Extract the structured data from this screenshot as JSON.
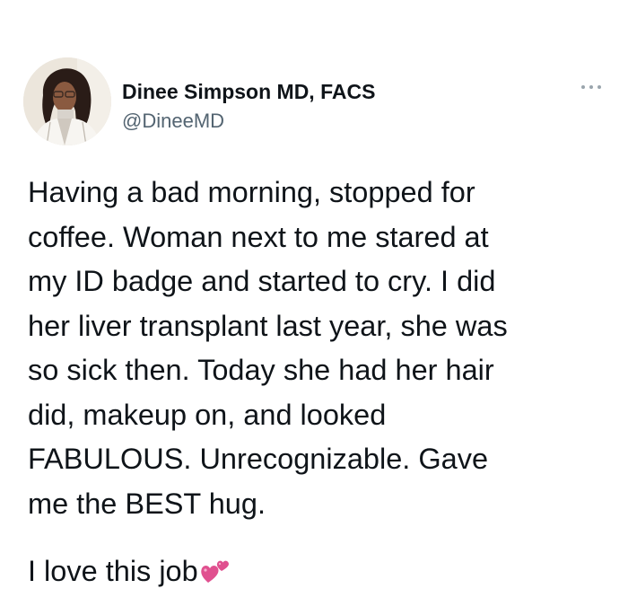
{
  "tweet": {
    "author": {
      "display_name": "Dinee Simpson MD, FACS",
      "handle": "@DineeMD",
      "avatar_icon": "profile-photo"
    },
    "more_icon": "more-options-icon",
    "text": "Having a bad morning, stopped for\ncoffee. Woman next to me stared at\nmy ID badge and started to cry. I did\nher liver transplant last year, she was\nso sick then. Today she had her hair\ndid, makeup on, and looked\nFABULOUS.  Unrecognizable. Gave\nme the BEST hug.",
    "closing_line": "I love this job",
    "closing_emoji": "two-hearts-icon",
    "colors": {
      "text": "#0f1419",
      "handle": "#536471",
      "heart": "#e0508f"
    }
  }
}
